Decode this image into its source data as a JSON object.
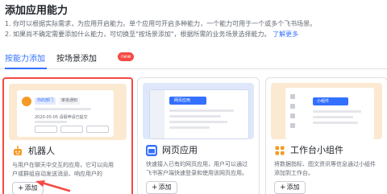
{
  "page": {
    "title": "添加应用能力",
    "desc_line1": "1. 你可以根据实际需求，为应用开启能力。单个应用可开启多种能力，一个能力可用于一个或多个飞书场景。",
    "desc_line2": "2. 如果尚不确定需要添加什么能力，可切换至\"按场景添加\"，根据所需的业务场景选择能力。",
    "learn_more": "了解更多"
  },
  "tabs": [
    {
      "label": "按能力添加",
      "active": true
    },
    {
      "label": "按场景添加",
      "active": false,
      "badge": "new"
    }
  ],
  "cards": [
    {
      "title": "机器人",
      "icon": "robot-icon",
      "desc_line1": "与用户在聊天中交互的应用，它可以向用",
      "desc_line2": "户或群组自动发送消息、响应用户的",
      "add_label": "添加",
      "highlighted": true,
      "preview": {
        "pill_a": "你的部门",
        "pill_b": "审批通知",
        "date": "2020-05-05 请假申请已提交"
      }
    },
    {
      "title": "网页应用",
      "icon": "web-app-icon",
      "desc_line1": "快速接入已有的网页应用，用户可以通过",
      "desc_line2": "飞书客户端快速登录和使用该网页应用。",
      "add_label": "添加",
      "highlighted": false,
      "preview": {
        "tag": "网页应用"
      }
    },
    {
      "title": "工作台小组件",
      "icon": "widget-icon",
      "desc_line1": "将数据指标、图文资讯等信息通过小组件",
      "desc_line2": "添加到工作台。",
      "add_label": "添加",
      "highlighted": false,
      "preview": {
        "tag": "小组件"
      }
    }
  ],
  "colors": {
    "accent": "#3370ff",
    "highlight_border": "#f54a45",
    "badge": "#f54a45"
  }
}
